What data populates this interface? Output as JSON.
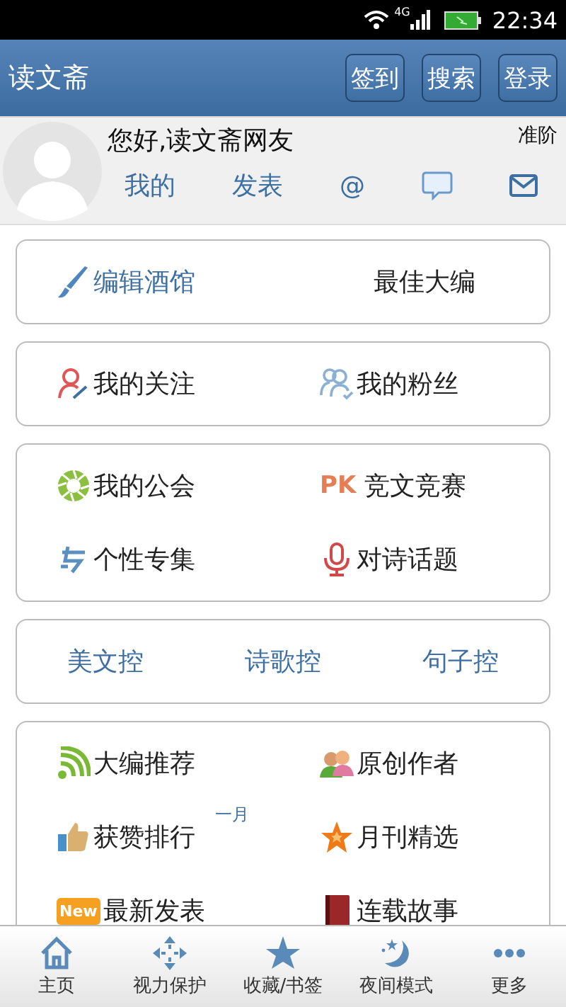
{
  "status_bar": {
    "network": "4G",
    "time": "22:34"
  },
  "header": {
    "title": "读文斋",
    "buttons": [
      "签到",
      "搜索",
      "登录"
    ]
  },
  "profile": {
    "greeting": "您好,读文斋网友",
    "rank": "准阶",
    "links": [
      {
        "kind": "text",
        "label": "我的"
      },
      {
        "kind": "text",
        "label": "发表"
      },
      {
        "kind": "text",
        "label": "@"
      },
      {
        "kind": "comment"
      },
      {
        "kind": "mail"
      }
    ]
  },
  "sections": [
    {
      "kind": "grid",
      "items": [
        {
          "label": "编辑酒馆",
          "kind": "link"
        },
        {
          "label": "最佳大编",
          "kind": "plain"
        }
      ]
    },
    {
      "kind": "grid",
      "items": [
        {
          "label": "我的关注",
          "kind": "plain"
        },
        {
          "label": "我的粉丝",
          "kind": "plain"
        }
      ]
    },
    {
      "kind": "grid",
      "items": [
        {
          "label": "我的公会",
          "kind": "plain"
        },
        {
          "label": "竞文竞赛",
          "kind": "plain",
          "icon_text": "PK"
        },
        {
          "label": "个性专集",
          "kind": "plain"
        },
        {
          "label": "对诗话题",
          "kind": "plain"
        }
      ]
    },
    {
      "kind": "row",
      "items": [
        {
          "label": "美文控",
          "kind": "link"
        },
        {
          "label": "诗歌控",
          "kind": "link"
        },
        {
          "label": "句子控",
          "kind": "link"
        }
      ]
    },
    {
      "kind": "grid",
      "items": [
        {
          "label": "大编推荐",
          "kind": "plain"
        },
        {
          "label": "原创作者",
          "kind": "plain"
        },
        {
          "label": "获赞排行",
          "kind": "plain",
          "note": "一月"
        },
        {
          "label": "月刊精选",
          "kind": "plain"
        },
        {
          "label": "最新发表",
          "kind": "plain",
          "icon_text": "New"
        },
        {
          "label": "连载故事",
          "kind": "plain"
        }
      ]
    }
  ],
  "nav": [
    {
      "label": "主页"
    },
    {
      "label": "视力保护"
    },
    {
      "label": "收藏/书签"
    },
    {
      "label": "夜间模式"
    },
    {
      "label": "更多"
    }
  ]
}
